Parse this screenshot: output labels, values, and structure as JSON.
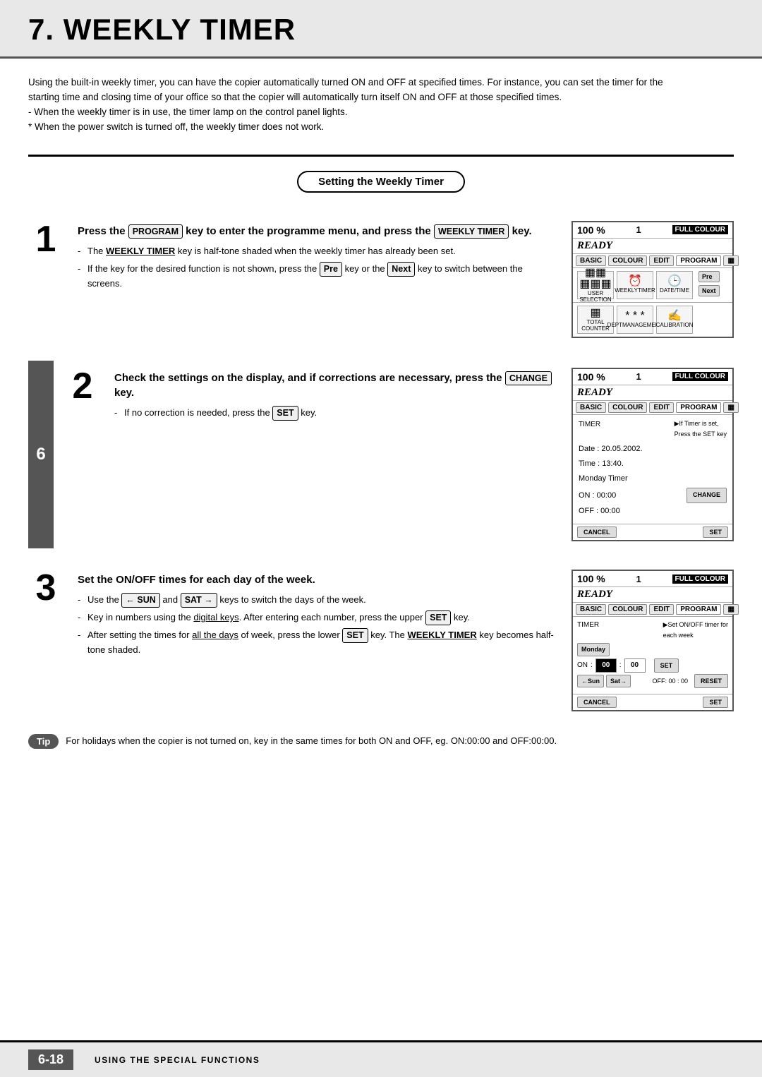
{
  "page": {
    "title": "7. WEEKLY TIMER",
    "footer_page": "6-18",
    "footer_label": "USING THE SPECIAL FUNCTIONS"
  },
  "intro": {
    "text1": "Using the built-in weekly timer, you can have the copier automatically turned ON and OFF at specified times.  For instance, you can set the timer for the starting time and closing time of your office so that the copier will automatically turn itself ON and OFF at those specified times.",
    "bullet1": "- When the weekly timer is in use, the timer lamp on the control panel lights.",
    "bullet2": "* When the power switch is turned off, the weekly timer does not work."
  },
  "section_heading": "Setting the Weekly Timer",
  "steps": [
    {
      "number": "1",
      "heading": "Press the  PROGRAM  key to enter the programme menu, and press the  WEEKLY TIMER  key.",
      "bullets": [
        "The WEEKLY TIMER key is half-tone shaded when the weekly timer has already been set.",
        "If the key for the desired function is not shown, press the Pre key or the Next key to switch between the screens."
      ]
    },
    {
      "number": "2",
      "heading": "Check the settings on the display, and if corrections are necessary, press the  CHANGE  key.",
      "bullets": [
        "If no correction is needed, press the SET key."
      ]
    },
    {
      "number": "3",
      "heading": "Set the ON/OFF times for each day of the week.",
      "bullets": [
        "Use the ← SUN and SAT → keys to switch the days of the week.",
        "Key in numbers using the digital keys.  After entering each number, press the upper SET key.",
        "After setting the times for all the days of week, press the lower SET key.  The WEEKLY TIMER key becomes half-tone shaded."
      ]
    }
  ],
  "tip": {
    "label": "Tip",
    "text": "For holidays when the copier is not turned on, key in the same times for both ON and OFF, eg. ON:00:00 and OFF:00:00."
  },
  "screens": [
    {
      "pct": "100 %",
      "num": "1",
      "colour": "FULL COLOUR",
      "ready": "READY",
      "tabs": [
        "BASIC",
        "COLOUR",
        "EDIT",
        "PROGRAM"
      ],
      "icons": [
        {
          "symbol": "▦▦",
          "label": "USER SELECTION"
        },
        {
          "symbol": "⏰",
          "label": "WEEKLYTIMER"
        },
        {
          "symbol": "🕐",
          "label": "DATE/TIME"
        },
        {
          "symbol": "▦",
          "label": "TOTAL COUNTER"
        },
        {
          "symbol": "***",
          "label": "DEPARTMENT"
        },
        {
          "symbol": "✍",
          "label": "CALIBRATION"
        }
      ],
      "side_btns": [
        "Pre",
        "Next"
      ]
    },
    {
      "pct": "100 %",
      "num": "1",
      "colour": "FULL COLOUR",
      "ready": "READY",
      "tabs": [
        "BASIC",
        "COLOUR",
        "EDIT",
        "PROGRAM"
      ],
      "timer_label": "TIMER",
      "timer_msg": "▶If Timer is set, Press the SET key",
      "date_label": "Date :",
      "date_val": "20.05.2002.",
      "time_label": "Time :",
      "time_val": "13:40.",
      "day_label": "Monday Timer",
      "on_label": "ON  :",
      "on_val": "00:00",
      "off_label": "OFF :",
      "off_val": "00:00",
      "btns": [
        "CHANGE"
      ],
      "bottom_btns": [
        "CANCEL",
        "SET"
      ]
    },
    {
      "pct": "100 %",
      "num": "1",
      "colour": "FULL COLOUR",
      "ready": "READY",
      "tabs": [
        "BASIC",
        "COLOUR",
        "EDIT",
        "PROGRAM"
      ],
      "timer_label": "TIMER",
      "timer_msg": "▶Set ON/OFF timer for each week",
      "day_btn": "Monday",
      "on_label": "ON",
      "on_h": "00",
      "on_m": "00",
      "set_btn": "SET",
      "nav_left": "←Sun",
      "nav_right": "Sat→",
      "off_label": "OFF:",
      "off_val": "00 : 00",
      "reset_btn": "RESET",
      "bottom_btns": [
        "CANCEL",
        "SET"
      ]
    }
  ]
}
